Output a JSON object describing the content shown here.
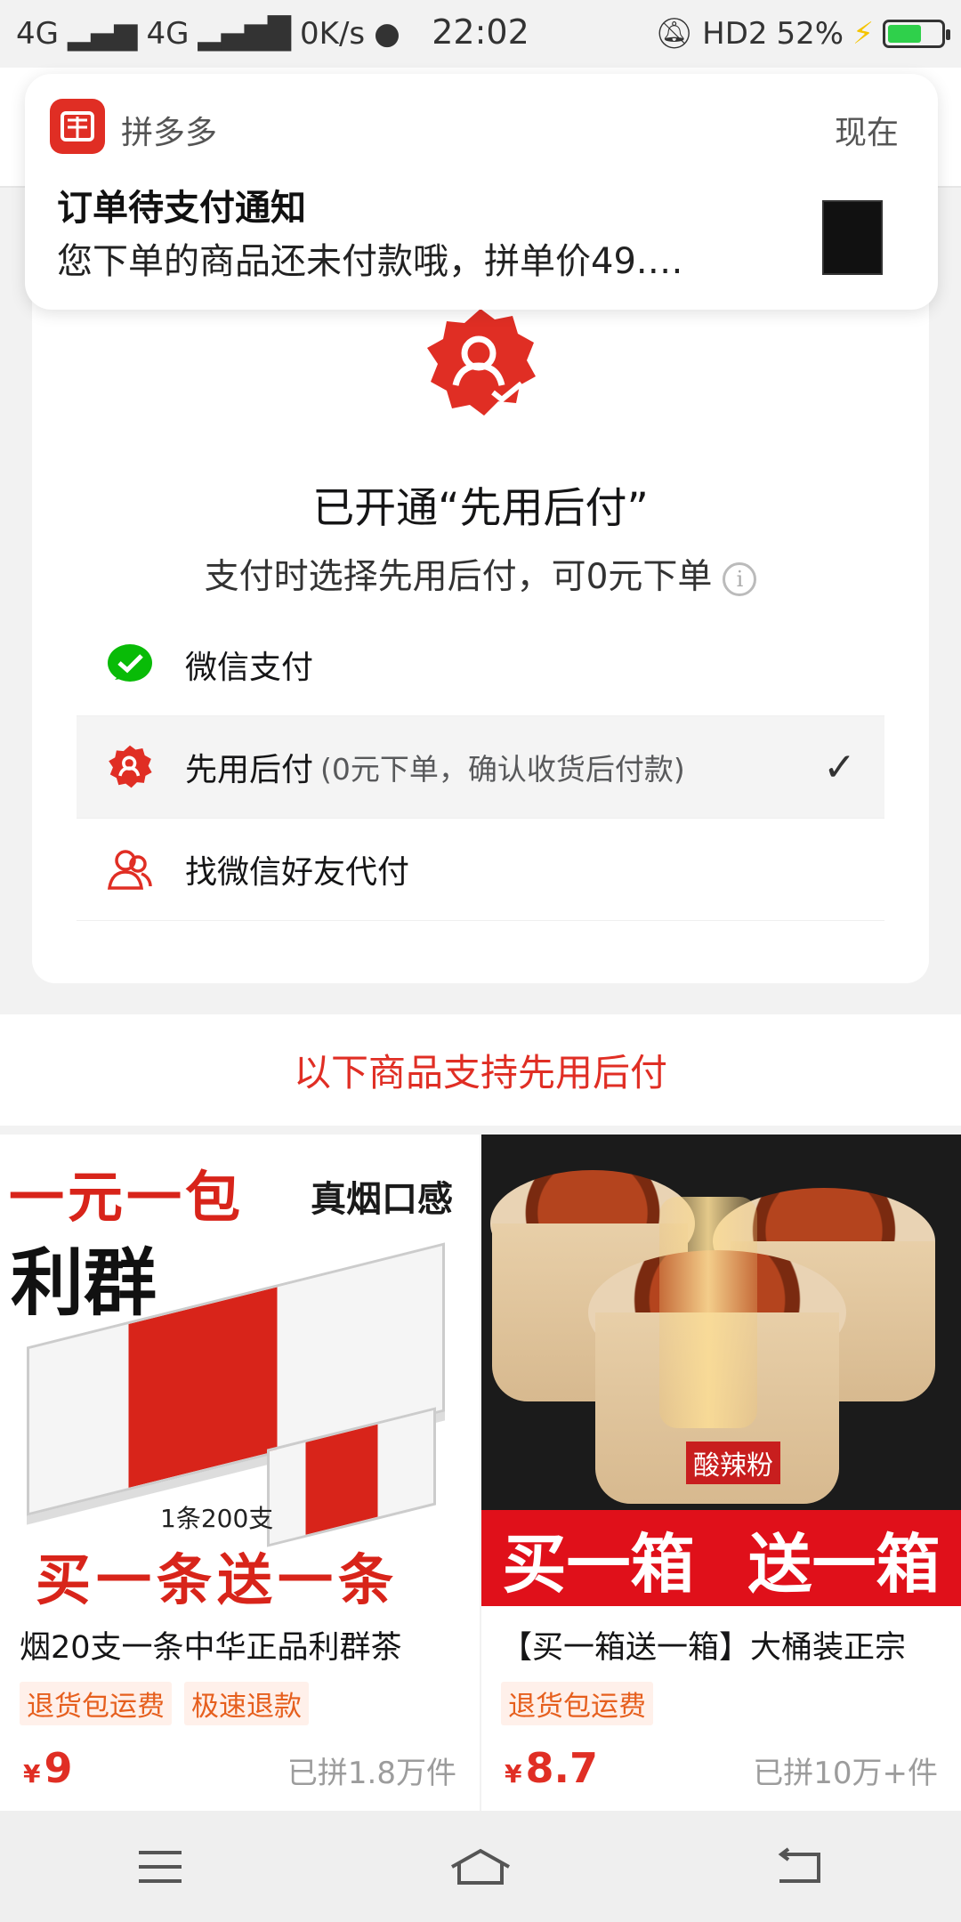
{
  "status_bar": {
    "network1": "4G",
    "network2": "4G",
    "speed": "0K/s",
    "time": "22:02",
    "hd": "HD2",
    "battery": "52%",
    "battery_level": 0.52
  },
  "notification": {
    "app_name": "拼多多",
    "time": "现在",
    "title": "订单待支付通知",
    "body": "您下单的商品还未付款哦，拼单价49.…"
  },
  "main": {
    "title": "已开通“先用后付”",
    "subtitle": "支付时选择先用后付，可0元下单",
    "info_icon": "info-icon",
    "payment_options": [
      {
        "label": "微信支付",
        "note": "",
        "icon": "wechat-pay-icon",
        "selected": false
      },
      {
        "label": "先用后付",
        "note": "(0元下单，确认收货后付款)",
        "icon": "pay-later-icon",
        "selected": true
      },
      {
        "label": "找微信好友代付",
        "note": "",
        "icon": "friends-pay-icon",
        "selected": false
      }
    ],
    "check_mark": "✓"
  },
  "support_text": "以下商品支持先用后付",
  "products": [
    {
      "title": "烟20支一条中华正品利群茶",
      "tags": [
        "退货包运费",
        "极速退款"
      ],
      "price_symbol": "¥",
      "price": "9",
      "sold": "已拼1.8万件",
      "image": {
        "banner_top": "一元一包",
        "banner_top2": "真烟口感",
        "brand": "利群",
        "count": "1条200支",
        "banner_bottom": "买一条送一条"
      }
    },
    {
      "title": "【买一箱送一箱】大桶装正宗",
      "tags": [
        "退货包运费"
      ],
      "price_symbol": "¥",
      "price": "8.7",
      "sold": "已拼10万+件",
      "image": {
        "label": "酸辣粉",
        "banner_left": "买一箱",
        "banner_right": "送一箱"
      }
    }
  ],
  "colors": {
    "brand_red": "#e02e24",
    "wechat_green": "#09bb07",
    "tag_orange": "#e65f1e"
  }
}
